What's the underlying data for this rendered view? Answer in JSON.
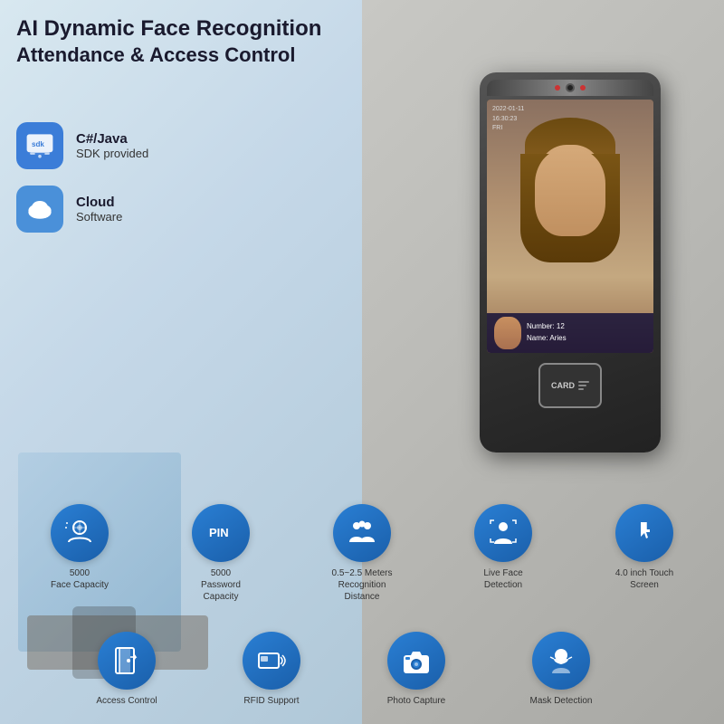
{
  "title": {
    "line1": "AI Dynamic Face Recognition",
    "line2": "Attendance & Access Control"
  },
  "badges": [
    {
      "icon": "sdk-icon",
      "iconType": "sdk",
      "label": "C#/Java",
      "sublabel": "SDK provided"
    },
    {
      "icon": "cloud-icon",
      "iconType": "cloud",
      "label": "Cloud",
      "sublabel": "Software"
    }
  ],
  "device": {
    "time": "2022-01-11\n16:30:23\nFRI",
    "person_name": "Aries",
    "person_number": "12",
    "card_label": "CARD"
  },
  "features_row1": [
    {
      "icon": "face-capacity-icon",
      "label": "5000\nFace Capacity"
    },
    {
      "icon": "pin-icon",
      "label": "5000\nPassword Capacity"
    },
    {
      "icon": "group-icon",
      "label": "0.5~2.5 Meters\nRecognition Distance"
    },
    {
      "icon": "face-detection-icon",
      "label": "Live Face Detection"
    },
    {
      "icon": "touch-icon",
      "label": "4.0 inch Touch Screen"
    }
  ],
  "features_row2": [
    {
      "icon": "access-control-icon",
      "label": "Access Control"
    },
    {
      "icon": "rfid-icon",
      "label": "RFID Support"
    },
    {
      "icon": "camera-icon",
      "label": "Photo Capture"
    },
    {
      "icon": "mask-icon",
      "label": "Mask Detection"
    }
  ]
}
